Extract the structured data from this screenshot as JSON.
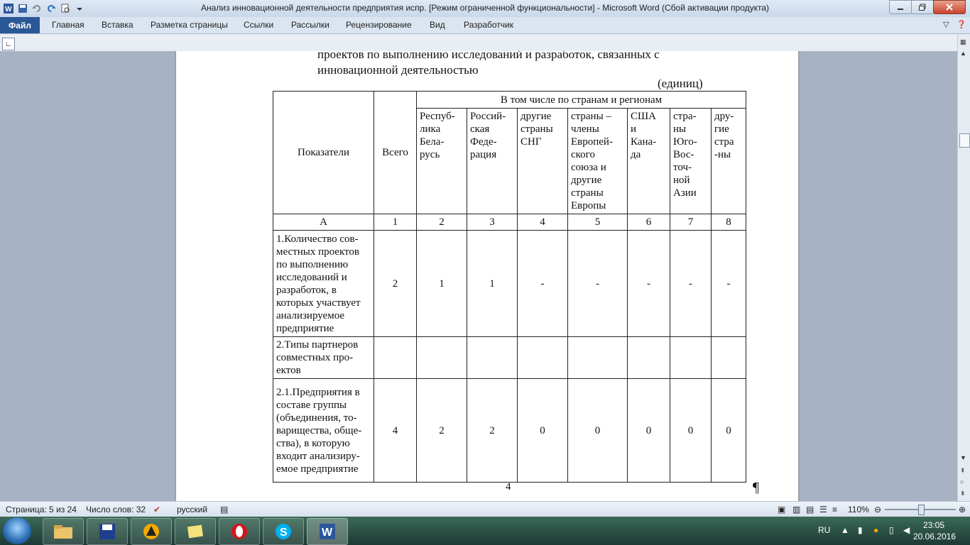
{
  "window": {
    "title": "Анализ инновационной деятельности предприятия испр. [Режим ограниченной функциональности]  -  Microsoft Word (Сбой активации продукта)"
  },
  "ribbon": {
    "file": "Файл",
    "tabs": [
      "Главная",
      "Вставка",
      "Разметка страницы",
      "Ссылки",
      "Рассылки",
      "Рецензирование",
      "Вид",
      "Разработчик"
    ]
  },
  "document": {
    "heading_line1": "проектов по выполнению исследований и разработок, связанных с",
    "heading_line2": "инновационной деятельностью",
    "units": "(единиц)",
    "page_number": "4",
    "pilcrow": "¶",
    "table": {
      "col_indicators": "Показатели",
      "col_total": "Всего",
      "col_group": "В том числе по странам и регионам",
      "countries": [
        [
          "Респуб-",
          "лика",
          "Бела-",
          "русь"
        ],
        [
          "Россий-",
          "ская",
          "Феде-",
          "рация"
        ],
        [
          "другие",
          "страны",
          "СНГ"
        ],
        [
          "страны –",
          "члены",
          "Европей-",
          "ского",
          "союза и",
          "другие",
          "страны",
          "Европы"
        ],
        [
          "США",
          "и",
          "Кана-",
          "да"
        ],
        [
          "стра-",
          "ны",
          "Юго-",
          "Вос-",
          "точ-",
          "ной",
          "Азии"
        ],
        [
          "дру-",
          "гие",
          "стра",
          "-ны"
        ]
      ],
      "index_row": [
        "А",
        "1",
        "2",
        "3",
        "4",
        "5",
        "6",
        "7",
        "8"
      ],
      "rows": [
        {
          "label_lines": [
            "1.Количество сов-",
            "местных проектов",
            "по выполнению",
            "исследований и",
            "разработок, в",
            "которых участвует",
            "анализируемое",
            "предприятие"
          ],
          "values": [
            "2",
            "1",
            "1",
            "-",
            "-",
            "-",
            "-",
            "-"
          ]
        },
        {
          "label_lines": [
            "2.Типы партнеров",
            "совместных про-",
            "ектов"
          ],
          "values": [
            "",
            "",
            "",
            "",
            "",
            "",
            "",
            ""
          ]
        },
        {
          "label_lines": [
            "2.1.Предприятия в",
            "составе группы",
            "(объединения, то-",
            "варищества, обще-",
            "ства), в которую",
            "входит анализиру-",
            "емое предприятие"
          ],
          "values": [
            "4",
            "2",
            "2",
            "0",
            "0",
            "0",
            "0",
            "0"
          ]
        }
      ]
    }
  },
  "statusbar": {
    "page": "Страница: 5 из 24",
    "words": "Число слов: 32",
    "language": "русский",
    "zoom": "110%"
  },
  "taskbar": {
    "lang": "RU",
    "time": "23:05",
    "date": "20.06.2016"
  }
}
